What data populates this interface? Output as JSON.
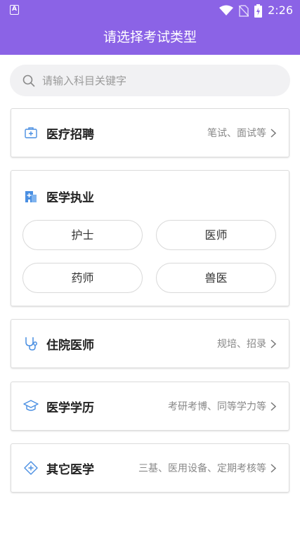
{
  "status_bar": {
    "time": "2:26",
    "left_icon_letter": "A"
  },
  "header": {
    "title": "请选择考试类型"
  },
  "search": {
    "placeholder": "请输入科目关键字"
  },
  "categories": [
    {
      "title": "医疗招聘",
      "subtitle": "笔试、面试等",
      "icon": "medical-kit-icon"
    },
    {
      "title": "医学执业",
      "icon": "hospital-icon",
      "options": [
        "护士",
        "医师",
        "药师",
        "兽医"
      ]
    },
    {
      "title": "住院医师",
      "subtitle": "规培、招录",
      "icon": "stethoscope-icon"
    },
    {
      "title": "医学学历",
      "subtitle": "考研考博、同等学力等",
      "icon": "graduation-cap-icon"
    },
    {
      "title": "其它医学",
      "subtitle": "三基、医用设备、定期考核等",
      "icon": "medical-diamond-icon"
    }
  ],
  "colors": {
    "brand": "#8b63e6",
    "icon_accent": "#4a8fe2"
  }
}
